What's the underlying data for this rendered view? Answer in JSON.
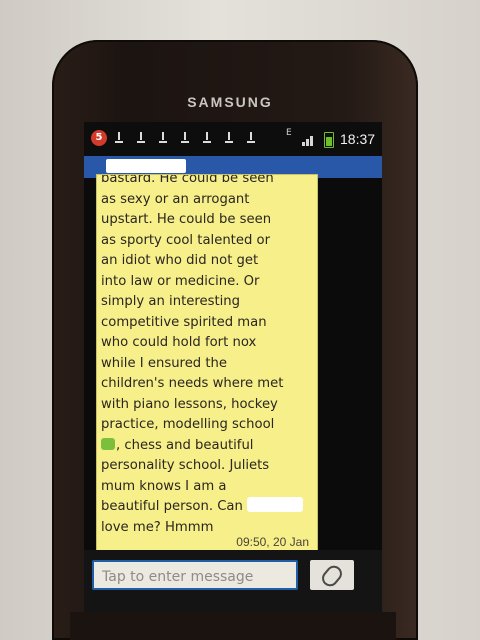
{
  "device": {
    "brand": "SAMSUNG"
  },
  "status_bar": {
    "notification_count": "5",
    "network_label": "E",
    "time": "18:37",
    "icons": [
      "notification-icon",
      "download-icon",
      "download-icon",
      "download-icon",
      "download-icon",
      "download-icon",
      "download-icon",
      "download-icon",
      "network-icon",
      "signal-icon",
      "battery-icon"
    ],
    "colors": {
      "badge": "#d23b2b",
      "battery": "#6fbf2c"
    }
  },
  "conversation": {
    "header_color": "#2a58a8",
    "bubble_color": "#f6ef8a",
    "message": {
      "text_before_redaction": "bastard. He could be seen\nas sexy or an arrogant\nupstart. He could be seen\nas sporty cool talented or\nan idiot who did not get\ninto law or medicine. Or\nsimply an interesting\ncompetitive spirited man\nwho could hold fort nox\nwhile I ensured the\nchildren's needs where met\nwith piano lessons, hockey\npractice, modelling school\n",
      "text_after_emoji": ", chess and beautiful\npersonality school. Juliets\nmum knows I am a\nbeautiful person. Can ",
      "text_after_redaction": "\nlove me? Hmmm",
      "timestamp": "09:50, 20 Jan"
    }
  },
  "composer": {
    "placeholder": "Tap to enter message",
    "attach_icon": "paperclip-icon"
  }
}
